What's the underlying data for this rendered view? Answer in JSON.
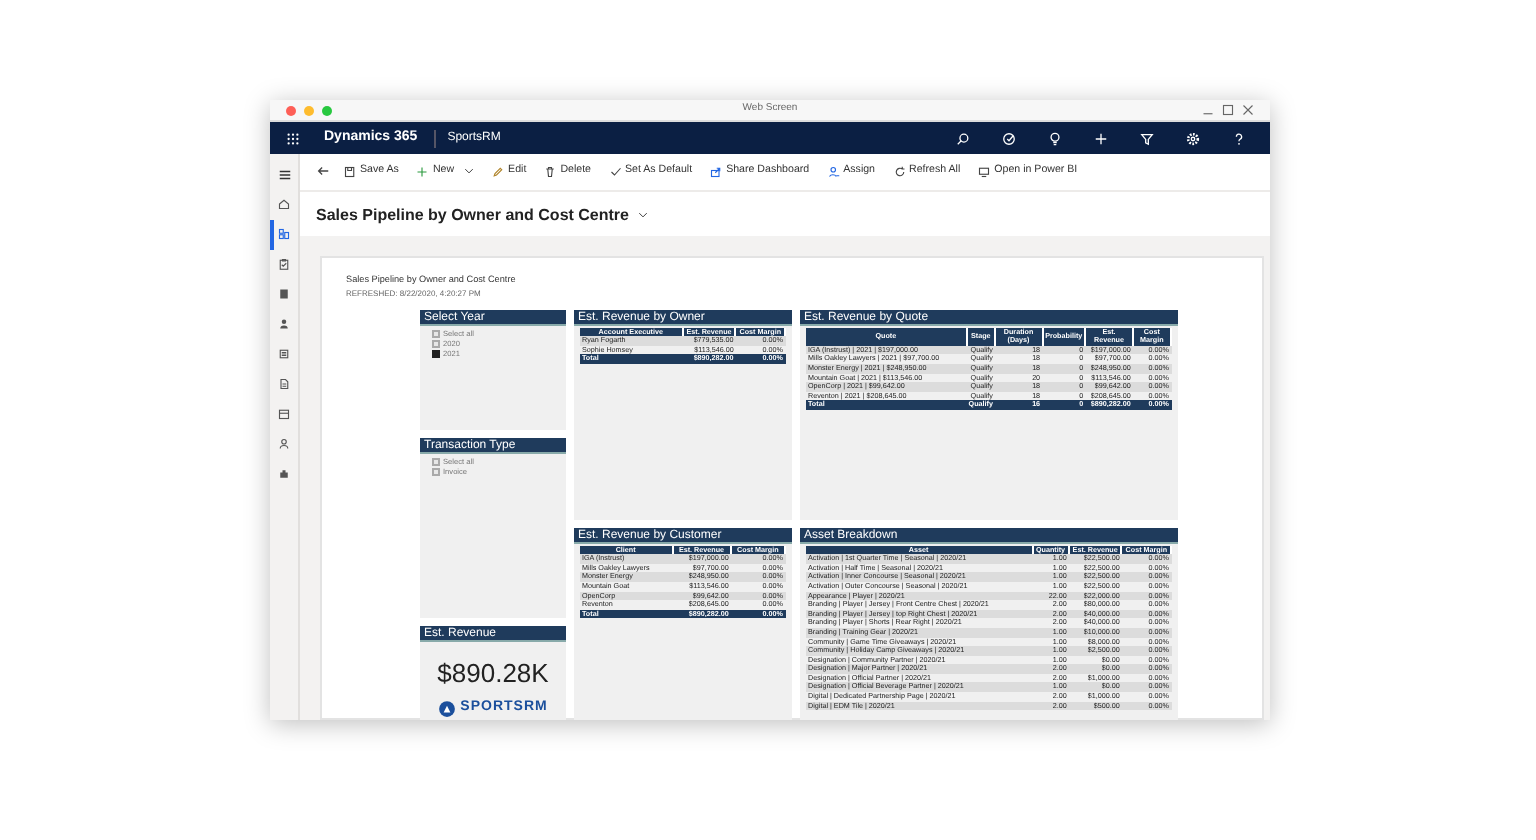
{
  "window": {
    "title": "Web Screen"
  },
  "app": {
    "product": "Dynamics 365",
    "area": "SportsRM"
  },
  "sidebar": [
    {
      "selected": false
    },
    {
      "selected": true
    },
    {
      "selected": false
    },
    {
      "selected": false
    },
    {
      "selected": false
    },
    {
      "selected": false
    },
    {
      "selected": false
    },
    {
      "selected": false
    },
    {
      "selected": false
    },
    {
      "selected": false
    }
  ],
  "commands": [
    {
      "label": "Save As",
      "dropdown": false
    },
    {
      "label": "New",
      "dropdown": true
    },
    {
      "label": "Edit",
      "dropdown": false
    },
    {
      "label": "Delete",
      "dropdown": false
    },
    {
      "label": "Set As Default",
      "dropdown": false
    },
    {
      "label": "Share Dashboard",
      "dropdown": false
    },
    {
      "label": "Assign",
      "dropdown": false
    },
    {
      "label": "Refresh All",
      "dropdown": false
    },
    {
      "label": "Open in Power BI",
      "dropdown": false
    }
  ],
  "page_title": "Sales Pipeline by Owner and Cost Centre",
  "report": {
    "title": "Sales Pipeline by Owner and Cost Centre",
    "refreshed": "REFRESHED: 8/22/2020, 4:20:27 PM",
    "select_year": {
      "title": "Select Year",
      "items": [
        {
          "label": "Select all",
          "checked": false
        },
        {
          "label": "2020",
          "checked": false
        },
        {
          "label": "2021",
          "checked": true
        }
      ]
    },
    "transaction_type": {
      "title": "Transaction Type",
      "items": [
        {
          "label": "Select all",
          "checked": false
        },
        {
          "label": "Invoice",
          "checked": false
        }
      ]
    },
    "est_revenue": {
      "title": "Est. Revenue",
      "value": "$890.28K",
      "logo": "SPORTSRM"
    },
    "by_owner": {
      "title": "Est. Revenue by Owner",
      "columns": [
        "Account Executive",
        "Est. Revenue",
        "Cost Margin"
      ],
      "rows": [
        [
          "Ryan Fogarth",
          "$779,535.00",
          "0.00%"
        ],
        [
          "Sophie Homsey",
          "$113,546.00",
          "0.00%"
        ]
      ],
      "total": [
        "Total",
        "$890,282.00",
        "0.00%"
      ]
    },
    "by_quote": {
      "title": "Est. Revenue by Quote",
      "columns": [
        "Quote",
        "Stage",
        "Duration (Days)",
        "Probability",
        "Est. Revenue",
        "Cost Margin"
      ],
      "rows": [
        [
          "IGA (Instrust) | 2021 | $197,000.00",
          "Qualify",
          "18",
          "0",
          "$197,000.00",
          "0.00%"
        ],
        [
          "Mills Oakley Lawyers | 2021 | $97,700.00",
          "Qualify",
          "18",
          "0",
          "$97,700.00",
          "0.00%"
        ],
        [
          "Monster Energy | 2021 | $248,950.00",
          "Qualify",
          "18",
          "0",
          "$248,950.00",
          "0.00%"
        ],
        [
          "Mountain Goat | 2021 | $113,546.00",
          "Qualify",
          "20",
          "0",
          "$113,546.00",
          "0.00%"
        ],
        [
          "OpenCorp | 2021 | $99,642.00",
          "Qualify",
          "18",
          "0",
          "$99,642.00",
          "0.00%"
        ],
        [
          "Reventon | 2021 | $208,645.00",
          "Qualify",
          "18",
          "0",
          "$208,645.00",
          "0.00%"
        ]
      ],
      "total": [
        "Total",
        "Qualify",
        "16",
        "0",
        "$890,282.00",
        "0.00%"
      ]
    },
    "by_customer": {
      "title": "Est. Revenue by Customer",
      "columns": [
        "Client",
        "Est. Revenue",
        "Cost Margin"
      ],
      "rows": [
        [
          "IGA (Instrust)",
          "$197,000.00",
          "0.00%"
        ],
        [
          "Mills Oakley Lawyers",
          "$97,700.00",
          "0.00%"
        ],
        [
          "Monster Energy",
          "$248,950.00",
          "0.00%"
        ],
        [
          "Mountain Goat",
          "$113,546.00",
          "0.00%"
        ],
        [
          "OpenCorp",
          "$99,642.00",
          "0.00%"
        ],
        [
          "Reventon",
          "$208,645.00",
          "0.00%"
        ]
      ],
      "total": [
        "Total",
        "$890,282.00",
        "0.00%"
      ]
    },
    "asset_breakdown": {
      "title": "Asset Breakdown",
      "columns": [
        "Asset",
        "Quantity",
        "Est. Revenue",
        "Cost Margin"
      ],
      "rows": [
        [
          "Activation | 1st Quarter Time | Seasonal | 2020/21",
          "1.00",
          "$22,500.00",
          "0.00%"
        ],
        [
          "Activation | Half Time | Seasonal | 2020/21",
          "1.00",
          "$22,500.00",
          "0.00%"
        ],
        [
          "Activation | Inner Concourse | Seasonal | 2020/21",
          "1.00",
          "$22,500.00",
          "0.00%"
        ],
        [
          "Activation | Outer Concourse | Seasonal | 2020/21",
          "1.00",
          "$22,500.00",
          "0.00%"
        ],
        [
          "Appearance | Player | 2020/21",
          "22.00",
          "$22,000.00",
          "0.00%"
        ],
        [
          "Branding | Player | Jersey | Front Centre Chest | 2020/21",
          "2.00",
          "$80,000.00",
          "0.00%"
        ],
        [
          "Branding | Player | Jersey | top Right Chest | 2020/21",
          "2.00",
          "$40,000.00",
          "0.00%"
        ],
        [
          "Branding | Player | Shorts | Rear Right | 2020/21",
          "2.00",
          "$40,000.00",
          "0.00%"
        ],
        [
          "Branding | Training Gear | 2020/21",
          "1.00",
          "$10,000.00",
          "0.00%"
        ],
        [
          "Community | Game Time Giveaways | 2020/21",
          "1.00",
          "$8,000.00",
          "0.00%"
        ],
        [
          "Community | Holiday Camp Giveaways | 2020/21",
          "1.00",
          "$2,500.00",
          "0.00%"
        ],
        [
          "Designation | Community Partner | 2020/21",
          "1.00",
          "$0.00",
          "0.00%"
        ],
        [
          "Designation | Major Partner | 2020/21",
          "2.00",
          "$0.00",
          "0.00%"
        ],
        [
          "Designation | Official Partner | 2020/21",
          "2.00",
          "$1,000.00",
          "0.00%"
        ],
        [
          "Designation | Official Beverage Partner | 2020/21",
          "1.00",
          "$0.00",
          "0.00%"
        ],
        [
          "Digital | Dedicated Partnership Page | 2020/21",
          "2.00",
          "$1,000.00",
          "0.00%"
        ],
        [
          "Digital | EDM Tile | 2020/21",
          "2.00",
          "$500.00",
          "0.00%"
        ]
      ]
    }
  }
}
